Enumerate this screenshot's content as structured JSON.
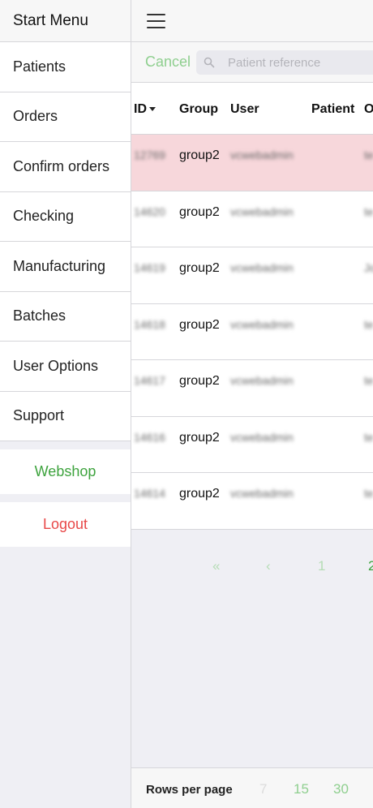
{
  "sidebar": {
    "title": "Start Menu",
    "items": [
      {
        "label": "Patients"
      },
      {
        "label": "Orders"
      },
      {
        "label": "Confirm orders"
      },
      {
        "label": "Checking"
      },
      {
        "label": "Manufacturing"
      },
      {
        "label": "Batches"
      },
      {
        "label": "User Options"
      },
      {
        "label": "Support"
      }
    ],
    "webshop": "Webshop",
    "logout": "Logout"
  },
  "search": {
    "cancel": "Cancel",
    "placeholder": "Patient reference"
  },
  "table": {
    "columns": [
      "ID",
      "Group",
      "User",
      "Patient",
      "O"
    ],
    "rows": [
      {
        "id": "12769",
        "group": "group2",
        "user": "vcwebadmin",
        "other": "te"
      },
      {
        "id": "14620",
        "group": "group2",
        "user": "vcwebadmin",
        "other": "te"
      },
      {
        "id": "14619",
        "group": "group2",
        "user": "vcwebadmin",
        "other": "Jo"
      },
      {
        "id": "14618",
        "group": "group2",
        "user": "vcwebadmin",
        "other": "te"
      },
      {
        "id": "14617",
        "group": "group2",
        "user": "vcwebadmin",
        "other": "te"
      },
      {
        "id": "14616",
        "group": "group2",
        "user": "vcwebadmin",
        "other": "te"
      },
      {
        "id": "14614",
        "group": "group2",
        "user": "vcwebadmin",
        "other": "te"
      }
    ]
  },
  "pagination": {
    "first": "«",
    "prev": "‹",
    "page1": "1",
    "page2": "2"
  },
  "footer": {
    "rows_per_page_label": "Rows per page",
    "options": [
      "7",
      "15",
      "30"
    ]
  },
  "colors": {
    "accent_green": "#3ea33e",
    "logout_red": "#e84848",
    "highlight_row": "#f7d7db"
  }
}
